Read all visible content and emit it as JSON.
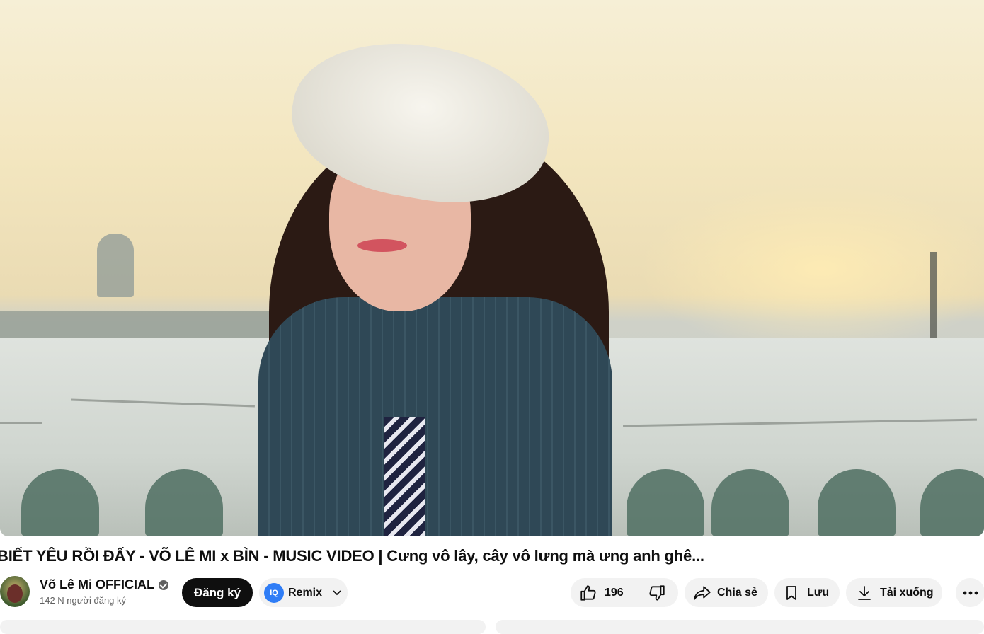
{
  "video": {
    "title": "BIẾT YÊU RỒI ĐẤY - VÕ LÊ MI x BÌN - MUSIC VIDEO | Cưng vô lây, cây vô lưng mà ưng anh ghê..."
  },
  "channel": {
    "name": "Võ Lê Mi OFFICIAL",
    "subscribers": "142 N người đăng ký",
    "verified": true
  },
  "actions": {
    "subscribe_label": "Đăng ký",
    "remix_label": "Remix",
    "like_count": "196",
    "share_label": "Chia sẻ",
    "save_label": "Lưu",
    "download_label": "Tải xuống"
  },
  "icons": {
    "remix": "remix-icon",
    "chevron": "chevron-down-icon",
    "like": "thumbs-up-icon",
    "dislike": "thumbs-down-icon",
    "share": "share-arrow-icon",
    "save": "bookmark-icon",
    "download": "download-icon",
    "more": "more-horizontal-icon"
  },
  "colors": {
    "subscribe_bg": "#0f0f0f",
    "pill_bg": "#f2f2f2",
    "remix_icon": "#2f7df6"
  }
}
